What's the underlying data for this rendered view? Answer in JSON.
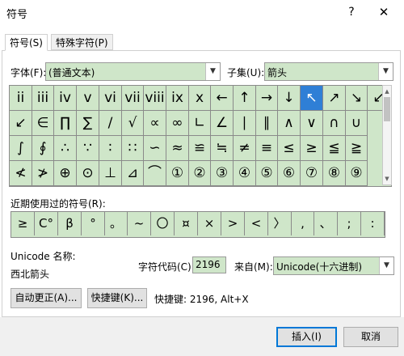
{
  "window": {
    "title": "符号",
    "help": "?",
    "close": "✕"
  },
  "tabs": [
    {
      "label": "符号(S)"
    },
    {
      "label": "特殊字符(P)"
    }
  ],
  "font": {
    "label": "字体(F):",
    "value": "(普通文本)"
  },
  "subset": {
    "label": "子集(U):",
    "value": "箭头"
  },
  "grid": {
    "rows": [
      [
        "ii",
        "iii",
        "iv",
        "v",
        "vi",
        "vii",
        "viii",
        "ix",
        "x",
        "←",
        "↑",
        "→",
        "↓",
        "↖",
        "↗",
        "↘",
        "↙"
      ],
      [
        "↙",
        "∈",
        "∏",
        "∑",
        "∕",
        "√",
        "∝",
        "∞",
        "∟",
        "∠",
        "∣",
        "∥",
        "∧",
        "∨",
        "∩",
        "∪"
      ],
      [
        "∫",
        "∮",
        "∴",
        "∵",
        "∶",
        "∷",
        "∽",
        "≈",
        "≌",
        "≒",
        "≠",
        "≡",
        "≤",
        "≥",
        "≦",
        "≧"
      ],
      [
        "≮",
        "≯",
        "⊕",
        "⊙",
        "⊥",
        "⊿",
        "⌒",
        "①",
        "②",
        "③",
        "④",
        "⑤",
        "⑥",
        "⑦",
        "⑧",
        "⑨"
      ]
    ],
    "selected": {
      "row": 0,
      "col": 13
    }
  },
  "recent": {
    "label": "近期使用过的符号(R):",
    "symbols": [
      "≥",
      "C°",
      "β",
      "°",
      "。",
      "~",
      "〇",
      "¤",
      "×",
      ">",
      "<",
      "〉",
      ",",
      "、",
      ";",
      ":"
    ]
  },
  "unicode": {
    "label": "Unicode 名称:",
    "name": "西北箭头"
  },
  "charcode": {
    "label": "字符代码(C):",
    "value": "2196"
  },
  "from": {
    "label": "来自(M):",
    "value": "Unicode(十六进制)"
  },
  "buttons": {
    "autocorrect": "自动更正(A)...",
    "shortcut": "快捷键(K)...",
    "shortcut_info": "快捷键: 2196, Alt+X",
    "insert": "插入(I)",
    "cancel": "取消"
  }
}
